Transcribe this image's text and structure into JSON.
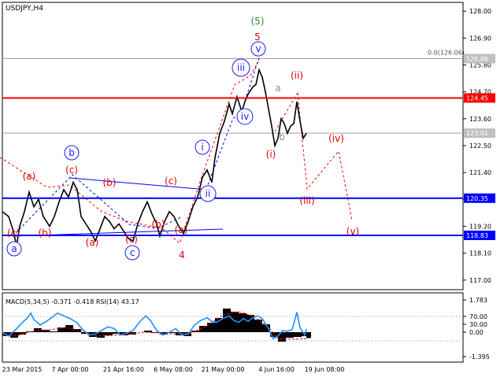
{
  "chart_data": [
    {
      "type": "line",
      "title": "USDJPY,H4",
      "subtitle": "",
      "xlabel": "",
      "ylabel": "",
      "ylim": [
        116.0,
        128.5
      ],
      "y_ticks": [
        "128.00",
        "126.90",
        "125.80",
        "124.70",
        "123.60",
        "122.50",
        "121.40",
        "120.30",
        "119.20",
        "118.10",
        "117.00"
      ],
      "x_ticks": [
        "23 Mar 2015",
        "7 Apr 00:00",
        "21 Apr 16:00",
        "6 May 08:00",
        "21 May 00:00",
        "4 Jun 16:00",
        "19 Jun 08:00"
      ],
      "price_series": [
        [
          0,
          119.8
        ],
        [
          8,
          119.6
        ],
        [
          14,
          119.0
        ],
        [
          18,
          118.4
        ],
        [
          22,
          119.2
        ],
        [
          28,
          119.8
        ],
        [
          34,
          120.6
        ],
        [
          40,
          120.0
        ],
        [
          46,
          120.3
        ],
        [
          52,
          119.6
        ],
        [
          60,
          119.2
        ],
        [
          66,
          119.6
        ],
        [
          72,
          120.2
        ],
        [
          78,
          120.7
        ],
        [
          84,
          120.4
        ],
        [
          90,
          121.0
        ],
        [
          95,
          120.7
        ],
        [
          100,
          119.6
        ],
        [
          106,
          119.3
        ],
        [
          112,
          119.0
        ],
        [
          118,
          118.6
        ],
        [
          124,
          119.1
        ],
        [
          130,
          119.6
        ],
        [
          136,
          119.4
        ],
        [
          142,
          119.1
        ],
        [
          148,
          119.3
        ],
        [
          154,
          119.0
        ],
        [
          160,
          118.7
        ],
        [
          166,
          118.6
        ],
        [
          172,
          119.3
        ],
        [
          178,
          119.8
        ],
        [
          184,
          120.2
        ],
        [
          190,
          119.7
        ],
        [
          196,
          119.3
        ],
        [
          200,
          118.8
        ],
        [
          206,
          119.4
        ],
        [
          212,
          119.8
        ],
        [
          218,
          119.6
        ],
        [
          224,
          119.2
        ],
        [
          230,
          118.9
        ],
        [
          236,
          119.4
        ],
        [
          242,
          120.0
        ],
        [
          248,
          120.4
        ],
        [
          254,
          121.2
        ],
        [
          260,
          121.5
        ],
        [
          266,
          121.0
        ],
        [
          270,
          122.0
        ],
        [
          276,
          123.0
        ],
        [
          282,
          123.5
        ],
        [
          288,
          124.2
        ],
        [
          292,
          123.8
        ],
        [
          298,
          124.5
        ],
        [
          304,
          123.9
        ],
        [
          308,
          124.3
        ],
        [
          312,
          124.6
        ],
        [
          318,
          124.9
        ],
        [
          322,
          125.0
        ],
        [
          326,
          125.6
        ],
        [
          330,
          125.3
        ],
        [
          334,
          124.7
        ],
        [
          338,
          124.0
        ],
        [
          342,
          123.3
        ],
        [
          346,
          122.5
        ],
        [
          350,
          122.8
        ],
        [
          354,
          123.6
        ],
        [
          358,
          123.4
        ],
        [
          362,
          123.0
        ],
        [
          366,
          123.3
        ],
        [
          370,
          123.4
        ],
        [
          374,
          124.3
        ],
        [
          378,
          123.5
        ],
        [
          382,
          122.8
        ],
        [
          386,
          123.0
        ]
      ],
      "annotations": [
        {
          "text": "(5)",
          "color": "green"
        },
        {
          "text": "5",
          "color": "red"
        },
        {
          "text": "v",
          "color": "blue",
          "circled": true
        },
        {
          "text": "iii",
          "color": "blue",
          "circled": true
        },
        {
          "text": "iv",
          "color": "blue",
          "circled": true
        },
        {
          "text": "i",
          "color": "blue",
          "circled": true
        },
        {
          "text": "ii",
          "color": "blue",
          "circled": true
        },
        {
          "text": "b",
          "color": "blue",
          "circled": true
        },
        {
          "text": "a",
          "color": "blue",
          "circled": true
        },
        {
          "text": "c",
          "color": "blue",
          "circled": true
        },
        {
          "text": "(a)",
          "color": "red"
        },
        {
          "text": "(c)",
          "color": "red"
        },
        {
          "text": "(b)",
          "color": "red"
        },
        {
          "text": "(a)",
          "color": "red"
        },
        {
          "text": "(b)",
          "color": "red"
        },
        {
          "text": "(c)",
          "color": "red"
        },
        {
          "text": "(b)",
          "color": "red"
        },
        {
          "text": "(a)",
          "color": "red"
        },
        {
          "text": "(c)",
          "color": "red"
        },
        {
          "text": "(c)",
          "color": "red"
        },
        {
          "text": "4",
          "color": "red"
        },
        {
          "text": "(i)",
          "color": "red"
        },
        {
          "text": "(ii)",
          "color": "red"
        },
        {
          "text": "(iii)",
          "color": "red"
        },
        {
          "text": "(iv)",
          "color": "red"
        },
        {
          "text": "(v)",
          "color": "red"
        },
        {
          "text": "a",
          "color": "gray"
        },
        {
          "text": "b",
          "color": "gray"
        }
      ],
      "hlines": [
        {
          "value": 124.45,
          "label": "124.45",
          "color": "#ff0000"
        },
        {
          "value": 120.35,
          "label": "120.35",
          "color": "#0000ff"
        },
        {
          "value": 118.83,
          "label": "118.83",
          "color": "#0000ff"
        }
      ],
      "gray_lines": [
        {
          "value": 126.06,
          "label": "126.06",
          "text": "0.0(126.06)"
        },
        {
          "value": 123.01,
          "label": "123.01"
        }
      ]
    },
    {
      "type": "line",
      "title": "MACD(5,34,5) -0.371 -0.418 RSI(14) 43.17",
      "y_ticks": [
        "1.783",
        "70.00",
        "30.00",
        "0.00",
        "-1.395"
      ],
      "ylim": [
        -1.395,
        1.783
      ],
      "macd": [
        [
          0,
          -0.25
        ],
        [
          10,
          -0.35
        ],
        [
          20,
          -0.15
        ],
        [
          30,
          0.05
        ],
        [
          40,
          0.25
        ],
        [
          50,
          0.15
        ],
        [
          60,
          0.05
        ],
        [
          70,
          0.3
        ],
        [
          80,
          0.45
        ],
        [
          90,
          0.2
        ],
        [
          100,
          -0.1
        ],
        [
          110,
          -0.3
        ],
        [
          120,
          -0.35
        ],
        [
          130,
          -0.2
        ],
        [
          140,
          -0.1
        ],
        [
          150,
          -0.2
        ],
        [
          160,
          -0.15
        ],
        [
          170,
          0.0
        ],
        [
          180,
          0.1
        ],
        [
          190,
          -0.05
        ],
        [
          200,
          -0.15
        ],
        [
          210,
          -0.05
        ],
        [
          220,
          -0.2
        ],
        [
          230,
          -0.25
        ],
        [
          240,
          0.1
        ],
        [
          250,
          0.4
        ],
        [
          260,
          0.6
        ],
        [
          270,
          0.9
        ],
        [
          280,
          1.5
        ],
        [
          290,
          1.3
        ],
        [
          300,
          1.2
        ],
        [
          310,
          1.1
        ],
        [
          320,
          0.8
        ],
        [
          330,
          0.5
        ],
        [
          340,
          -0.3
        ],
        [
          350,
          -0.6
        ],
        [
          360,
          -0.35
        ],
        [
          370,
          -0.3
        ],
        [
          380,
          -0.25
        ],
        [
          386,
          -0.37
        ]
      ],
      "signal": [
        [
          0,
          -0.2
        ],
        [
          20,
          -0.2
        ],
        [
          40,
          0.1
        ],
        [
          60,
          0.15
        ],
        [
          80,
          0.3
        ],
        [
          100,
          0.1
        ],
        [
          120,
          -0.25
        ],
        [
          140,
          -0.2
        ],
        [
          160,
          -0.15
        ],
        [
          180,
          0.0
        ],
        [
          200,
          -0.05
        ],
        [
          220,
          -0.12
        ],
        [
          240,
          -0.05
        ],
        [
          260,
          0.4
        ],
        [
          280,
          1.1
        ],
        [
          300,
          1.3
        ],
        [
          320,
          1.0
        ],
        [
          340,
          0.2
        ],
        [
          350,
          -0.4
        ],
        [
          360,
          -0.45
        ],
        [
          386,
          -0.42
        ]
      ],
      "rsi": [
        [
          0,
          35
        ],
        [
          8,
          28
        ],
        [
          16,
          40
        ],
        [
          24,
          55
        ],
        [
          32,
          68
        ],
        [
          36,
          78
        ],
        [
          40,
          64
        ],
        [
          48,
          52
        ],
        [
          56,
          60
        ],
        [
          64,
          70
        ],
        [
          70,
          78
        ],
        [
          78,
          72
        ],
        [
          86,
          66
        ],
        [
          94,
          58
        ],
        [
          102,
          42
        ],
        [
          110,
          30
        ],
        [
          118,
          32
        ],
        [
          126,
          40
        ],
        [
          134,
          48
        ],
        [
          142,
          44
        ],
        [
          150,
          30
        ],
        [
          158,
          34
        ],
        [
          166,
          40
        ],
        [
          174,
          58
        ],
        [
          182,
          72
        ],
        [
          188,
          62
        ],
        [
          196,
          40
        ],
        [
          204,
          30
        ],
        [
          212,
          36
        ],
        [
          220,
          44
        ],
        [
          228,
          30
        ],
        [
          236,
          32
        ],
        [
          244,
          52
        ],
        [
          252,
          62
        ],
        [
          260,
          68
        ],
        [
          266,
          60
        ],
        [
          272,
          58
        ],
        [
          280,
          66
        ],
        [
          288,
          72
        ],
        [
          294,
          62
        ],
        [
          300,
          58
        ],
        [
          306,
          66
        ],
        [
          312,
          60
        ],
        [
          318,
          68
        ],
        [
          324,
          72
        ],
        [
          330,
          66
        ],
        [
          338,
          44
        ],
        [
          344,
          22
        ],
        [
          350,
          28
        ],
        [
          356,
          40
        ],
        [
          362,
          38
        ],
        [
          368,
          42
        ],
        [
          374,
          80
        ],
        [
          378,
          46
        ],
        [
          384,
          30
        ],
        [
          386,
          43
        ]
      ]
    }
  ]
}
